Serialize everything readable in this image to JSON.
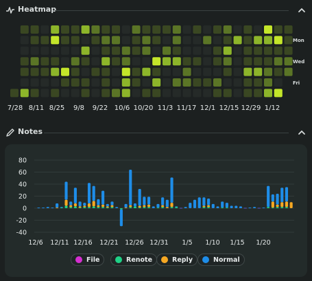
{
  "heatmap_section": {
    "title": "Heatmap",
    "x_ticks": [
      "7/28",
      "8/11",
      "8/25",
      "9/8",
      "9/22",
      "10/6",
      "10/20",
      "11/3",
      "11/17",
      "12/1",
      "12/15",
      "12/29",
      "1/12"
    ],
    "day_labels": [
      "Mon",
      "Wed",
      "Fri"
    ],
    "colors": {
      "empty": "#252a28",
      "low": "#3a4722",
      "mid": "#5b7526",
      "high": "#8db52a",
      "max": "#c4e62a"
    }
  },
  "notes_section": {
    "title": "Notes",
    "legend": [
      {
        "label": "File",
        "color": "#d52fd0"
      },
      {
        "label": "Renote",
        "color": "#1fd186"
      },
      {
        "label": "Reply",
        "color": "#f6a823"
      },
      {
        "label": "Normal",
        "color": "#1e8de8"
      }
    ]
  },
  "chart_data": {
    "type": "bar",
    "stacked": true,
    "y_ticks": [
      80,
      60,
      40,
      20,
      0,
      -20,
      -40
    ],
    "ylim": [
      -40,
      80
    ],
    "x_tick_labels": [
      "12/6",
      "12/11",
      "12/16",
      "12/21",
      "12/26",
      "12/31",
      "1/5",
      "1/10",
      "1/15",
      "1/20"
    ],
    "grid": true,
    "legend_position": "bottom",
    "series": [
      {
        "name": "File",
        "values": [
          0,
          0,
          0,
          0,
          0,
          0,
          0,
          0,
          0,
          0,
          0,
          0,
          0,
          0,
          0,
          0,
          0,
          0,
          0,
          0,
          0,
          0,
          0,
          0,
          0,
          0,
          0,
          0,
          0,
          0,
          0,
          0,
          0,
          0,
          0,
          0,
          0,
          0,
          0,
          0,
          0,
          0,
          0,
          0,
          0,
          0,
          0,
          0,
          0,
          0,
          0,
          0,
          0,
          0,
          0,
          0
        ]
      },
      {
        "name": "Renote",
        "values": [
          0,
          0,
          0,
          0,
          0,
          1,
          4,
          2,
          3,
          1,
          2,
          2,
          3,
          2,
          2,
          1,
          2,
          0,
          -2,
          0,
          2,
          3,
          1,
          2,
          2,
          0,
          1,
          2,
          0,
          2,
          2,
          0,
          0,
          0,
          0,
          0,
          2,
          2,
          0,
          0,
          1,
          1,
          0,
          0,
          0,
          0,
          0,
          0,
          0,
          0,
          2,
          1,
          2,
          2,
          2,
          0,
          0
        ]
      },
      {
        "name": "Reply",
        "values": [
          0,
          0,
          0,
          0,
          1,
          0,
          10,
          3,
          5,
          2,
          2,
          6,
          9,
          3,
          4,
          2,
          3,
          0,
          0,
          1,
          3,
          0,
          3,
          3,
          4,
          0,
          0,
          3,
          2,
          7,
          0,
          0,
          0,
          0,
          0,
          0,
          2,
          3,
          0,
          0,
          0,
          0,
          0,
          0,
          0,
          0,
          0,
          0,
          0,
          0,
          0,
          10,
          4,
          8,
          9,
          10,
          0
        ]
      },
      {
        "name": "Normal",
        "values": [
          1,
          1,
          2,
          1,
          7,
          1,
          30,
          6,
          26,
          8,
          5,
          34,
          25,
          10,
          23,
          4,
          6,
          2,
          -28,
          6,
          59,
          5,
          28,
          14,
          13,
          3,
          6,
          13,
          12,
          42,
          1,
          0,
          2,
          9,
          14,
          18,
          14,
          11,
          7,
          3,
          10,
          8,
          4,
          4,
          3,
          0,
          1,
          2,
          0,
          1,
          35,
          12,
          18,
          24,
          24,
          0
        ]
      }
    ]
  }
}
